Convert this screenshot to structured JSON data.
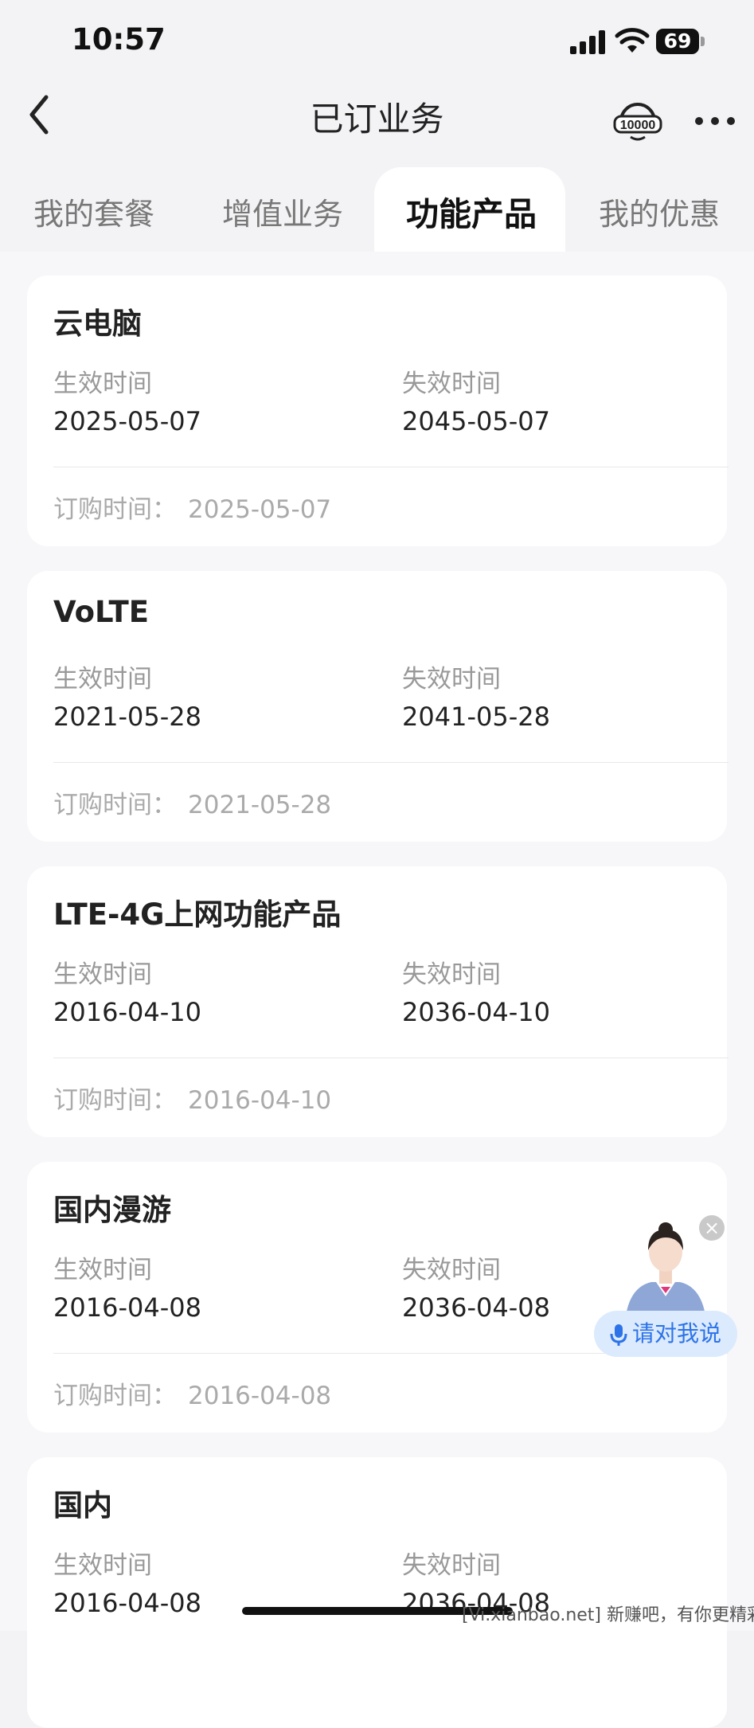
{
  "status_bar": {
    "time": "10:57",
    "battery": "69"
  },
  "nav": {
    "title": "已订业务"
  },
  "tabs": [
    {
      "label": "我的套餐"
    },
    {
      "label": "增值业务"
    },
    {
      "label": "功能产品"
    },
    {
      "label": "我的优惠"
    }
  ],
  "labels": {
    "effective": "生效时间",
    "expiry": "失效时间",
    "ordered": "订购时间："
  },
  "cards": [
    {
      "name": "云电脑",
      "effective": "2025-05-07",
      "expiry": "2045-05-07",
      "ordered": "2025-05-07"
    },
    {
      "name": "VoLTE",
      "effective": "2021-05-28",
      "expiry": "2041-05-28",
      "ordered": "2021-05-28"
    },
    {
      "name": "LTE-4G上网功能产品",
      "effective": "2016-04-10",
      "expiry": "2036-04-10",
      "ordered": "2016-04-10"
    },
    {
      "name": "国内漫游",
      "effective": "2016-04-08",
      "expiry": "2036-04-08",
      "ordered": "2016-04-08"
    },
    {
      "name": "国内",
      "effective": "2016-04-08",
      "expiry": "2036-04-08"
    }
  ],
  "assistant": {
    "label": "请对我说"
  },
  "watermark": "[Vi.xianbao.net] 新赚吧，有你更精彩！",
  "colors": {
    "accent": "#2c73e8",
    "bg": "#f3f3f5"
  }
}
